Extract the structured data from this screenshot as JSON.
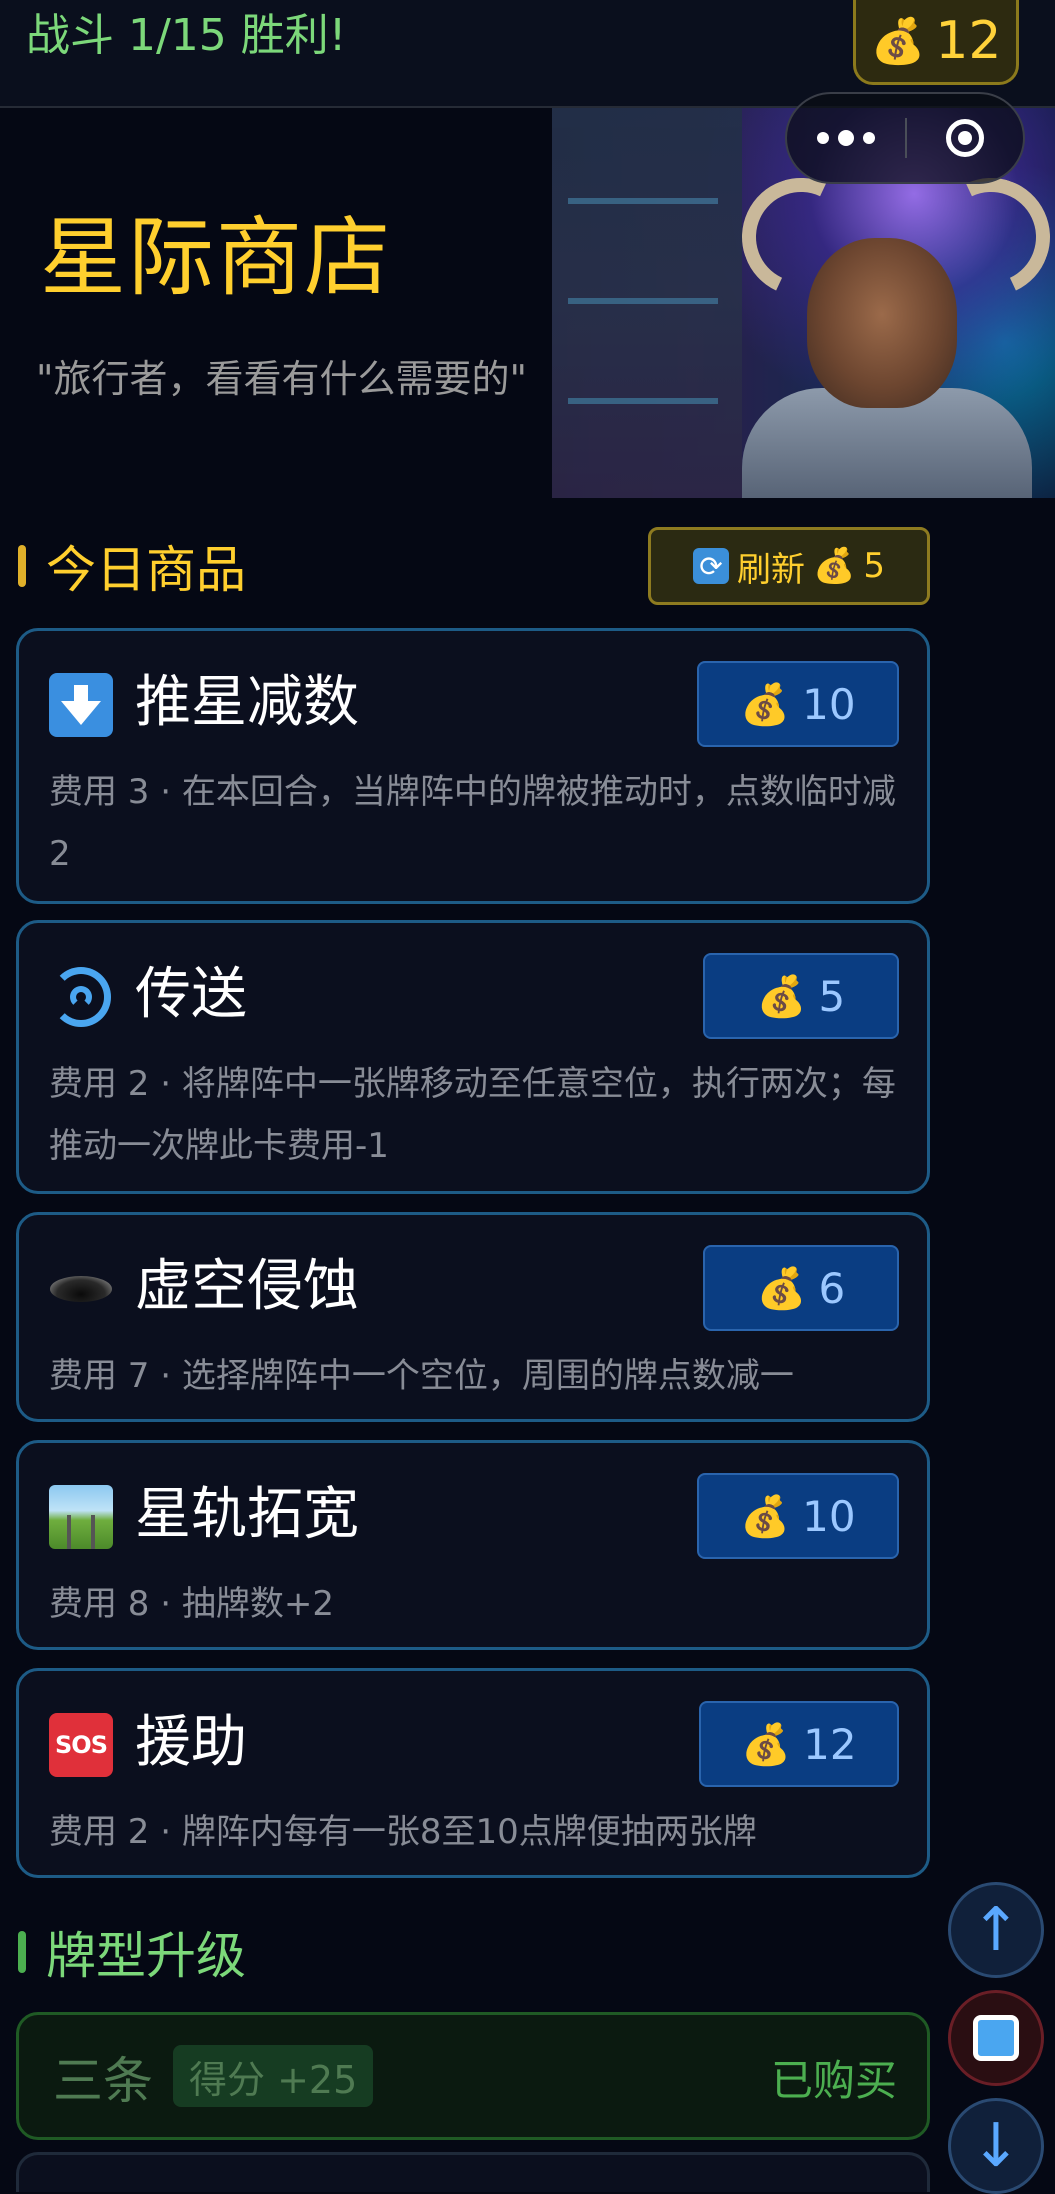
{
  "header": {
    "battle_status": "战斗 1/15 胜利!",
    "coins": "12",
    "coin_icon": "money-bag-icon"
  },
  "hero": {
    "title": "星际商店",
    "quote": "\"旅行者，看看有什么需要的\""
  },
  "today": {
    "section_title": "今日商品",
    "refresh_label": "刷新",
    "refresh_cost": "5",
    "items": [
      {
        "icon": "down-arrow-icon",
        "name": "推星减数",
        "price": "10",
        "desc": "费用 3 · 在本回合，当牌阵中的牌被推动时，点数临时减2"
      },
      {
        "icon": "swirl-icon",
        "name": "传送",
        "price": "5",
        "desc": "费用 2 · 将牌阵中一张牌移动至任意空位，执行两次；每推动一次牌此卡费用-1"
      },
      {
        "icon": "hole-icon",
        "name": "虚空侵蚀",
        "price": "6",
        "desc": "费用 7 · 选择牌阵中一个空位，周围的牌点数减一"
      },
      {
        "icon": "railway-icon",
        "name": "星轨拓宽",
        "price": "10",
        "desc": "费用 8 · 抽牌数+2"
      },
      {
        "icon": "sos-icon",
        "name": "援助",
        "price": "12",
        "desc": "费用 2 · 牌阵内每有一张8至10点牌便抽两张牌"
      }
    ]
  },
  "upgrades": {
    "section_title": "牌型升级",
    "items": [
      {
        "name": "三条",
        "tag": "得分 +25",
        "status": "已购买"
      }
    ]
  },
  "floating": {
    "up": "↑",
    "down": "↓"
  },
  "colors": {
    "accent_gold": "#ffcf2e",
    "accent_green": "#7cd87a",
    "price_blue": "#0a3d82",
    "card_border": "#1d5b86"
  }
}
